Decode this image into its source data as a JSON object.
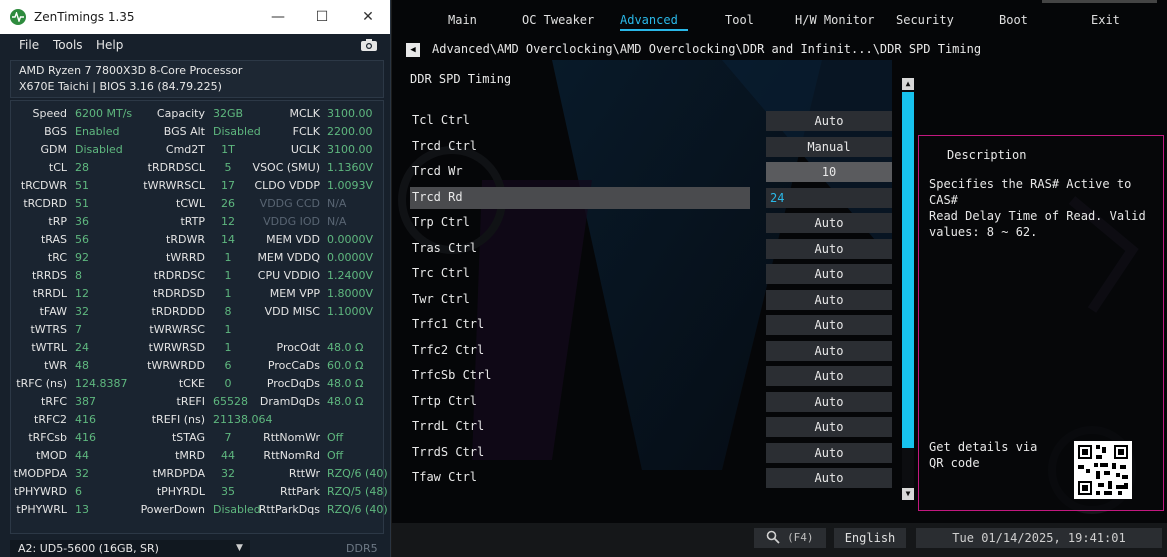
{
  "zentimings": {
    "title": "ZenTimings 1.35",
    "window_buttons": {
      "minimize": "—",
      "maximize": "☐",
      "close": "✕"
    },
    "menu": [
      "File",
      "Tools",
      "Help"
    ],
    "cpu": "AMD Ryzen 7 7800X3D 8-Core Processor",
    "board": "X670E Taichi | BIOS 3.16 (84.79.225)",
    "rows": [
      [
        "Speed",
        "6200 MT/s",
        "Capacity",
        "32GB",
        "MCLK",
        "3100.00"
      ],
      [
        "BGS",
        "Enabled",
        "BGS Alt",
        "Disabled",
        "FCLK",
        "2200.00"
      ],
      [
        "GDM",
        "Disabled",
        "Cmd2T",
        "1T",
        "UCLK",
        "3100.00"
      ],
      [
        "tCL",
        "28",
        "tRDRDSCL",
        "5",
        "VSOC (SMU)",
        "1.1360V"
      ],
      [
        "tRCDWR",
        "51",
        "tWRWRSCL",
        "17",
        "CLDO VDDP",
        "1.0093V"
      ],
      [
        "tRCDRD",
        "51",
        "tCWL",
        "26",
        "VDDG CCD",
        "N/A"
      ],
      [
        "tRP",
        "36",
        "tRTP",
        "12",
        "VDDG IOD",
        "N/A"
      ],
      [
        "tRAS",
        "56",
        "tRDWR",
        "14",
        "MEM VDD",
        "0.0000V"
      ],
      [
        "tRC",
        "92",
        "tWRRD",
        "1",
        "MEM VDDQ",
        "0.0000V"
      ],
      [
        "tRRDS",
        "8",
        "tRDRDSC",
        "1",
        "CPU VDDIO",
        "1.2400V"
      ],
      [
        "tRRDL",
        "12",
        "tRDRDSD",
        "1",
        "MEM VPP",
        "1.8000V"
      ],
      [
        "tFAW",
        "32",
        "tRDRDDD",
        "8",
        "VDD MISC",
        "1.1000V"
      ],
      [
        "tWTRS",
        "7",
        "tWRWRSC",
        "1",
        "",
        ""
      ],
      [
        "tWTRL",
        "24",
        "tWRWRSD",
        "1",
        "ProcOdt",
        "48.0 Ω"
      ],
      [
        "tWR",
        "48",
        "tWRWRDD",
        "6",
        "ProcCaDs",
        "60.0 Ω"
      ],
      [
        "tRFC (ns)",
        "124.8387",
        "tCKE",
        "0",
        "ProcDqDs",
        "48.0 Ω"
      ],
      [
        "tRFC",
        "387",
        "tREFI",
        "65528",
        "DramDqDs",
        "48.0 Ω"
      ],
      [
        "tRFC2",
        "416",
        "tREFI (ns)",
        "21138.064",
        "",
        ""
      ],
      [
        "tRFCsb",
        "416",
        "tSTAG",
        "7",
        "RttNomWr",
        "Off"
      ],
      [
        "tMOD",
        "44",
        "tMRD",
        "44",
        "RttNomRd",
        "Off"
      ],
      [
        "tMODPDA",
        "32",
        "tMRDPDA",
        "32",
        "RttWr",
        "RZQ/6 (40)"
      ],
      [
        "tPHYWRD",
        "6",
        "tPHYRDL",
        "35",
        "RttPark",
        "RZQ/5 (48)"
      ],
      [
        "tPHYWRL",
        "13",
        "PowerDown",
        "Disabled",
        "RttParkDqs",
        "RZQ/6 (40)"
      ]
    ],
    "module": "A2: UD5-5600 (16GB, SR)",
    "ddr": "DDR5"
  },
  "bios": {
    "tabs": [
      "Main",
      "OC Tweaker",
      "Advanced",
      "Tool",
      "H/W Monitor",
      "Security",
      "Boot",
      "Exit"
    ],
    "active_tab": "Advanced",
    "breadcrumb": "Advanced\\AMD Overclocking\\AMD Overclocking\\DDR and Infinit...\\DDR SPD Timing",
    "page_title": "DDR SPD Timing",
    "settings": [
      {
        "name": "Tcl Ctrl",
        "value": "Auto"
      },
      {
        "name": "Trcd Ctrl",
        "value": "Manual"
      },
      {
        "name": "Trcd Wr",
        "value": "10"
      },
      {
        "name": "Trcd Rd",
        "value": "24"
      },
      {
        "name": "Trp Ctrl",
        "value": "Auto"
      },
      {
        "name": "Tras Ctrl",
        "value": "Auto"
      },
      {
        "name": "Trc Ctrl",
        "value": "Auto"
      },
      {
        "name": "Twr Ctrl",
        "value": "Auto"
      },
      {
        "name": "Trfc1 Ctrl",
        "value": "Auto"
      },
      {
        "name": "Trfc2 Ctrl",
        "value": "Auto"
      },
      {
        "name": "TrfcSb Ctrl",
        "value": "Auto"
      },
      {
        "name": "Trtp Ctrl",
        "value": "Auto"
      },
      {
        "name": "TrrdL Ctrl",
        "value": "Auto"
      },
      {
        "name": "TrrdS Ctrl",
        "value": "Auto"
      },
      {
        "name": "Tfaw Ctrl",
        "value": "Auto"
      }
    ],
    "description": {
      "heading": "Description",
      "text": "Specifies the RAS# Active to CAS#\nRead Delay Time of Read. Valid\nvalues: 8 ~ 62.",
      "qr_text": "Get details via QR code"
    },
    "footer": {
      "search": "(F4)",
      "language": "English",
      "datetime": "Tue 01/14/2025, 19:41:01"
    },
    "colors": {
      "accent": "#2ab8e8",
      "desc_border": "#c2187f"
    }
  }
}
